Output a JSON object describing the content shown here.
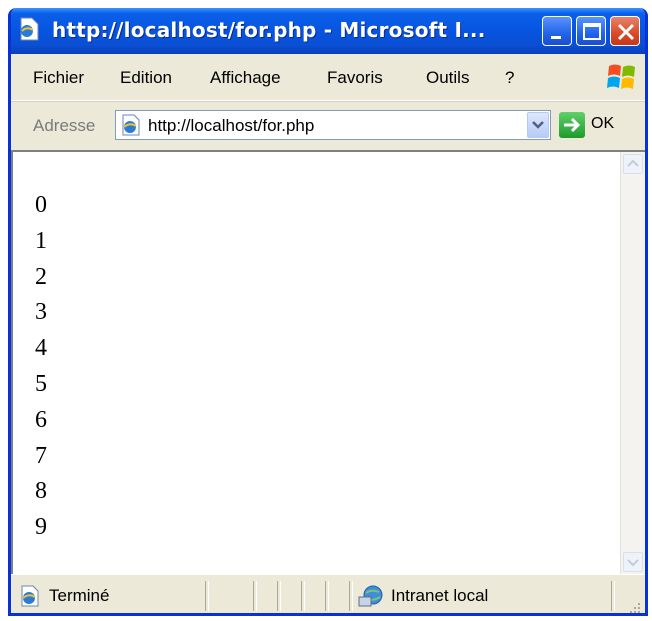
{
  "window": {
    "title": "http://localhost/for.php - Microsoft I..."
  },
  "menu": {
    "items": [
      "Fichier",
      "Edition",
      "Affichage",
      "Favoris",
      "Outils",
      "?"
    ]
  },
  "address": {
    "label": "Adresse",
    "url": "http://localhost/for.php",
    "go_label": "OK"
  },
  "page": {
    "output": [
      "0",
      "1",
      "2",
      "3",
      "4",
      "5",
      "6",
      "7",
      "8",
      "9"
    ]
  },
  "status": {
    "text": "Terminé",
    "zone": "Intranet local"
  },
  "icons": {
    "title": "ie-page-icon",
    "brand": "windows-logo-icon",
    "address": "ie-page-icon",
    "go": "green-arrow-icon",
    "status": "ie-page-icon",
    "zone": "intranet-globe-icon"
  },
  "colors": {
    "titlebar": "#0755e0",
    "frame": "#0831d9",
    "close_button": "#d94a27",
    "chrome": "#ece9d8",
    "go_arrow": "#1f9a2c"
  }
}
